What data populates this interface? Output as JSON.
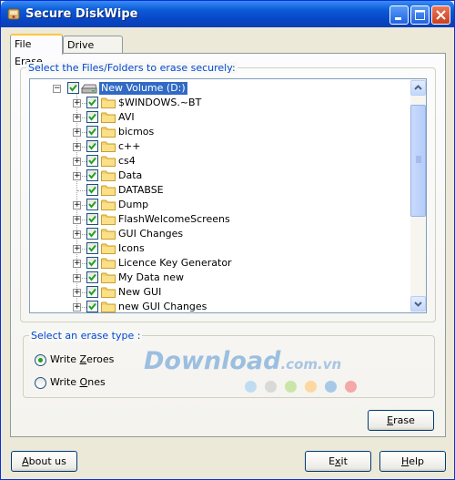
{
  "window": {
    "title": "Secure DiskWipe",
    "icons": [
      "app-icon",
      "minimize-icon",
      "maximize-icon",
      "close-icon"
    ]
  },
  "tabs": [
    {
      "label": "File Erase",
      "active": true
    },
    {
      "label": "Drive Erase",
      "active": false
    }
  ],
  "files_group": {
    "label": "Select the Files/Folders to erase securely:"
  },
  "tree": {
    "root": {
      "label": "New Volume (D:)",
      "checked": true,
      "expanded": true,
      "selected": true
    },
    "items": [
      {
        "label": "$WINDOWS.~BT",
        "checked": true,
        "expandable": true
      },
      {
        "label": "AVI",
        "checked": true,
        "expandable": true
      },
      {
        "label": "bicmos",
        "checked": true,
        "expandable": true
      },
      {
        "label": "c++",
        "checked": true,
        "expandable": true
      },
      {
        "label": "cs4",
        "checked": true,
        "expandable": true
      },
      {
        "label": "Data",
        "checked": true,
        "expandable": true
      },
      {
        "label": "DATABSE",
        "checked": true,
        "expandable": false
      },
      {
        "label": "Dump",
        "checked": true,
        "expandable": true
      },
      {
        "label": "FlashWelcomeScreens",
        "checked": true,
        "expandable": true
      },
      {
        "label": "GUI Changes",
        "checked": true,
        "expandable": true
      },
      {
        "label": "Icons",
        "checked": true,
        "expandable": true
      },
      {
        "label": "Licence Key Generator",
        "checked": true,
        "expandable": true
      },
      {
        "label": "My Data new",
        "checked": true,
        "expandable": true
      },
      {
        "label": "New GUI",
        "checked": true,
        "expandable": true
      },
      {
        "label": "new GUI Changes",
        "checked": true,
        "expandable": true
      }
    ]
  },
  "erase_type_group": {
    "label": "Select an erase type :",
    "options": [
      {
        "label_pre": "Write ",
        "label_key": "Z",
        "label_post": "eroes",
        "selected": true
      },
      {
        "label_pre": "Write ",
        "label_key": "O",
        "label_post": "nes",
        "selected": false
      }
    ]
  },
  "buttons": {
    "erase": {
      "key": "E",
      "rest": "rase"
    },
    "about": {
      "pre": "",
      "key": "A",
      "rest": "bout us"
    },
    "exit": {
      "pre": "E",
      "key": "x",
      "rest": "it"
    },
    "help": {
      "pre": "",
      "key": "H",
      "rest": "elp"
    }
  },
  "watermark": {
    "text": "Download",
    "domain": ".com.vn",
    "dot_colors": [
      "#bfdcf2",
      "#d9d9d9",
      "#c8e6a8",
      "#fbd8a0",
      "#a8c8e8",
      "#f4a8a8"
    ]
  },
  "colors": {
    "titlebar": "#0a5bd6",
    "group_label": "#0046d5",
    "selection": "#316ac5",
    "radio_dot": "#21a121"
  }
}
